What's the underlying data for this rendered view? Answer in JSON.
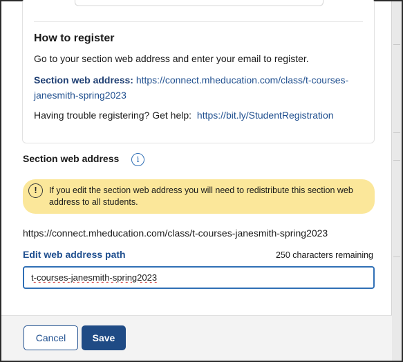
{
  "registration": {
    "title": "How to register",
    "instructions": "Go to your section web address and enter your email to register.",
    "url_label": "Section web address:",
    "url_value": "https://connect.mheducation.com/class/t-courses-janesmith-spring2023",
    "help_text": "Having trouble registering? Get help:",
    "help_link": "https://bit.ly/StudentRegistration"
  },
  "section": {
    "heading": "Section web address",
    "info_icon_glyph": "i",
    "alert_icon_glyph": "!",
    "alert_text": "If you edit the section web address you will need to redistribute this section web address to all students.",
    "full_url": "https://connect.mheducation.com/class/t-courses-janesmith-spring2023",
    "edit_label": "Edit web address path",
    "chars_remaining": "250 characters remaining",
    "path_value": "t-courses-janesmith-spring2023"
  },
  "footer": {
    "cancel_label": "Cancel",
    "save_label": "Save"
  },
  "colors": {
    "accent": "#1f4f8f",
    "primary_button": "#1f4b85",
    "alert_background": "#fbe79a",
    "input_focus": "#2f6fb5"
  }
}
